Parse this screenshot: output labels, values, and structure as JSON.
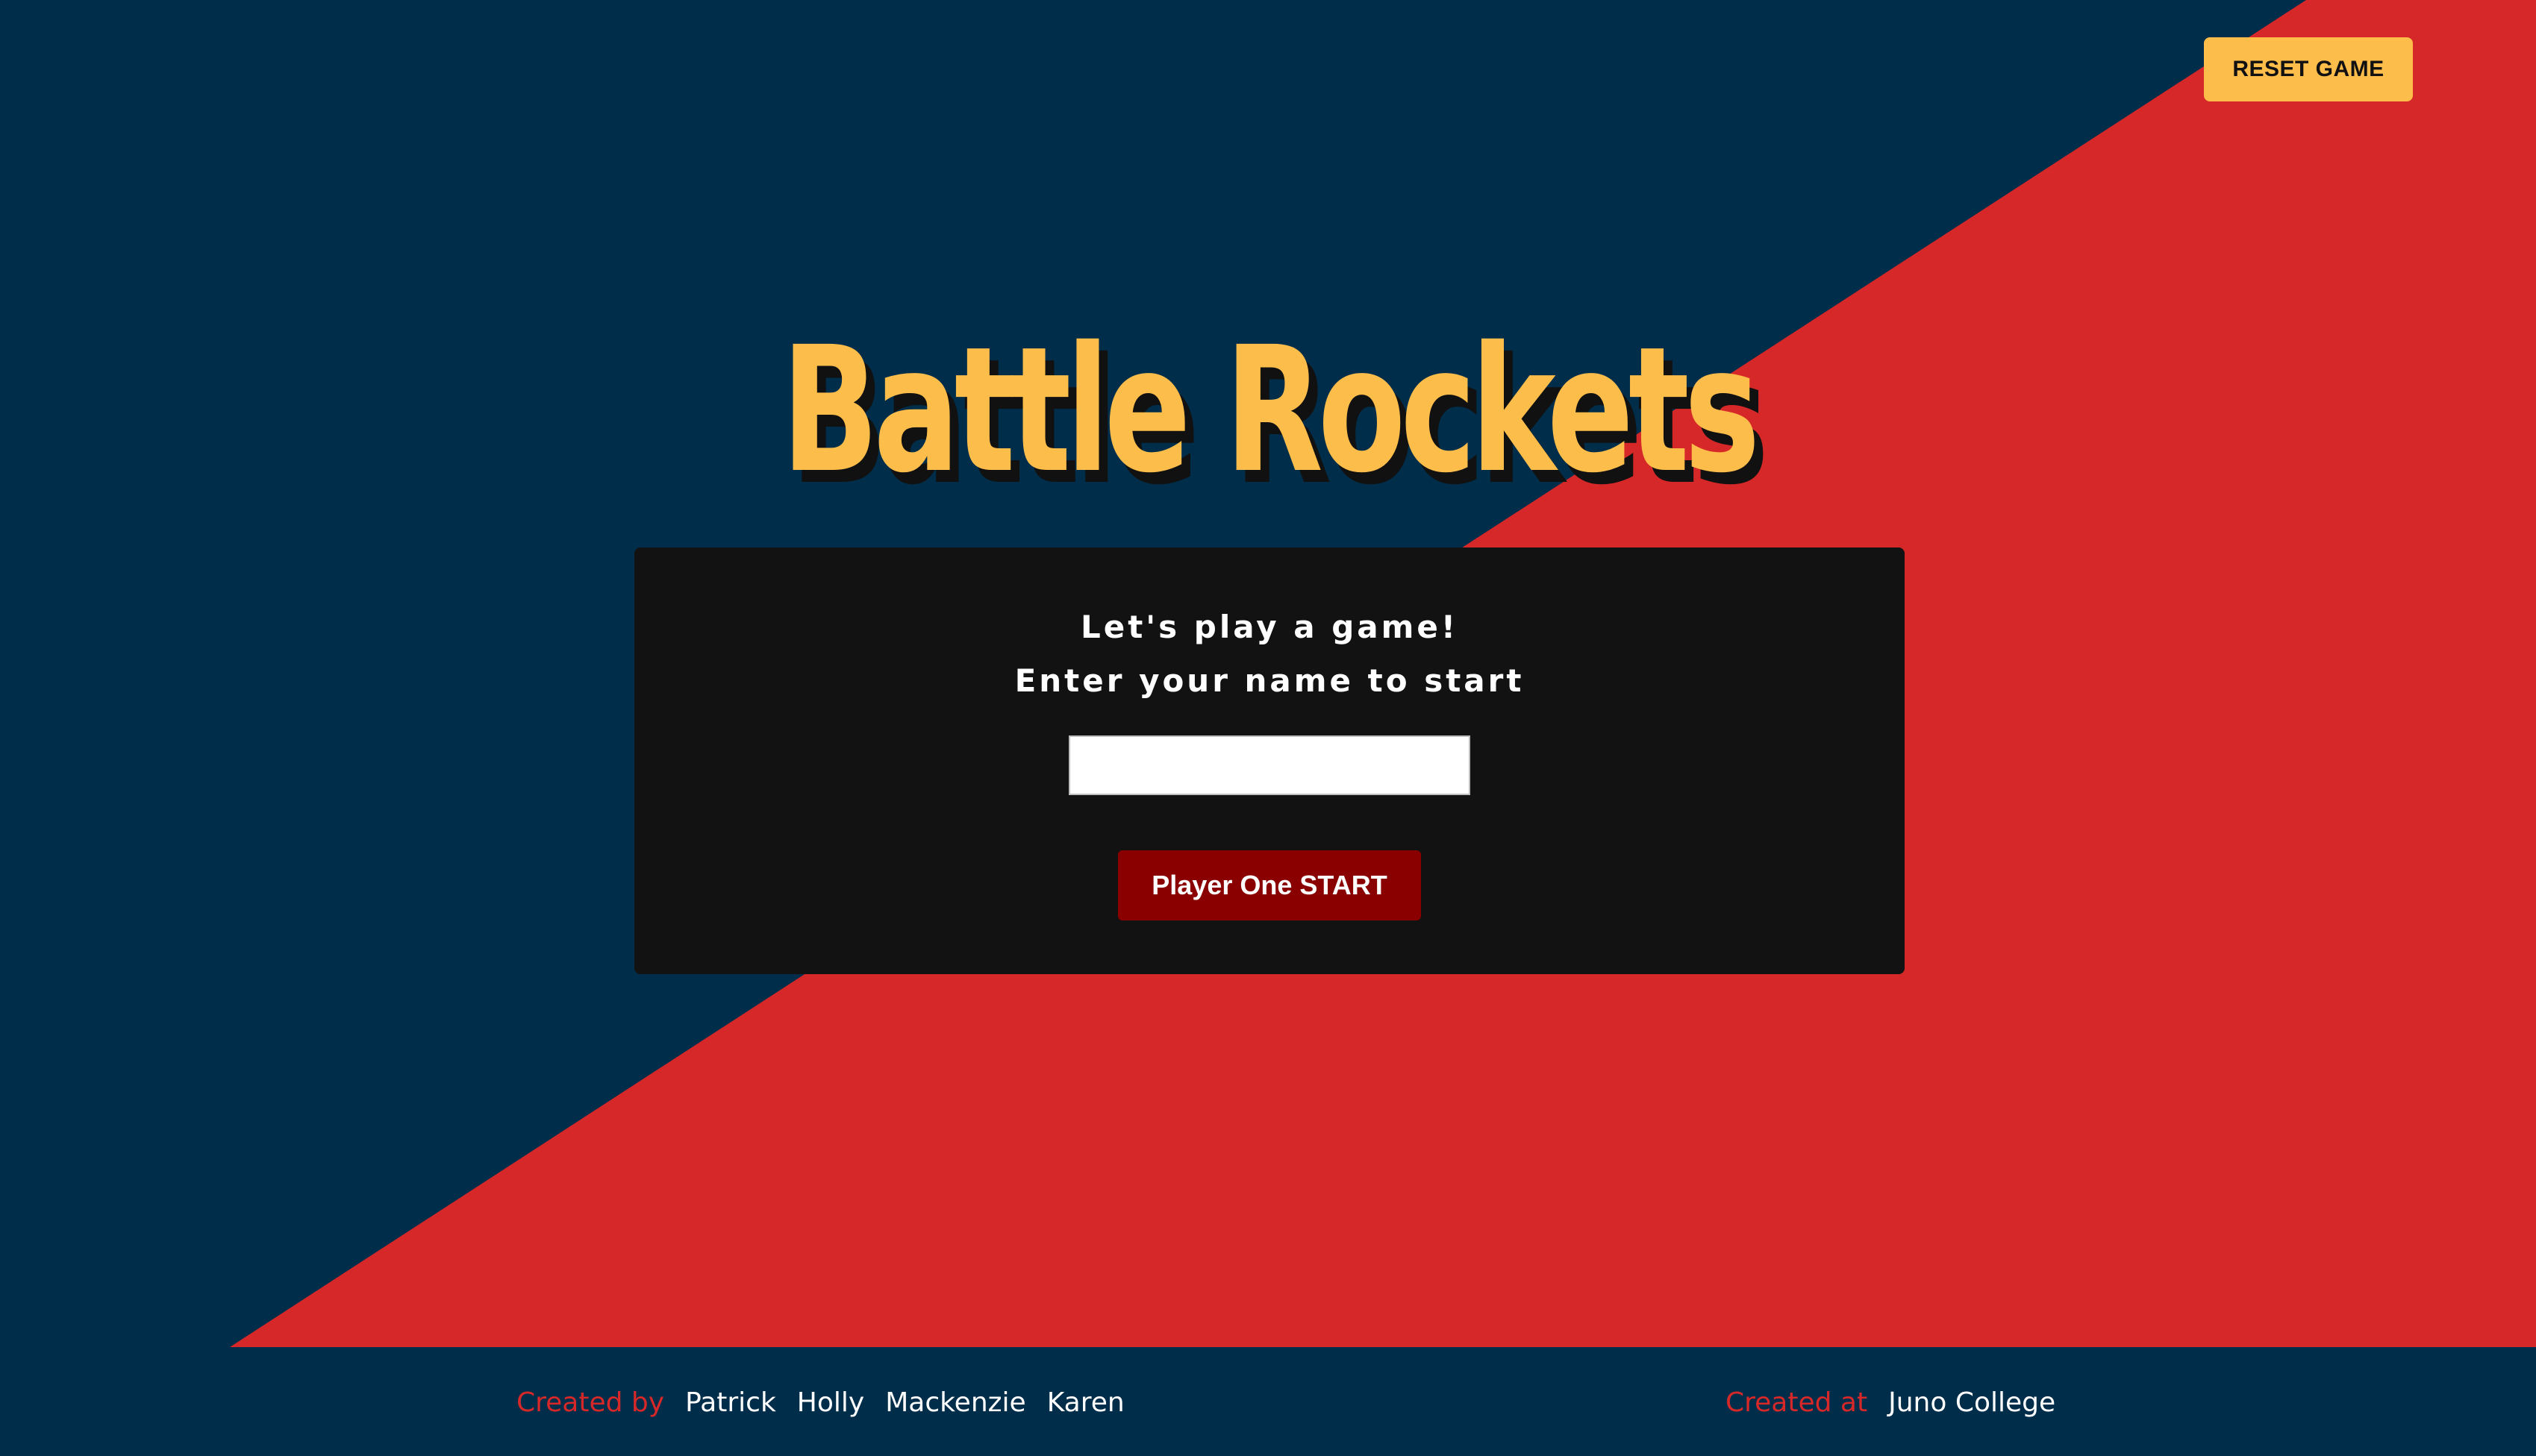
{
  "header": {
    "reset_label": "RESET GAME"
  },
  "title": "Battle Rockets",
  "panel": {
    "line1": "Let's play a game!",
    "line2": "Enter your name to start",
    "name_input_value": "",
    "start_label": "Player One START"
  },
  "footer": {
    "created_by_label": "Created by",
    "creators": [
      "Patrick",
      "Holly",
      "Mackenzie",
      "Karen"
    ],
    "created_at_label": "Created at",
    "school": "Juno College"
  },
  "colors": {
    "background_navy": "#002d4a",
    "diagonal_red": "#d62828",
    "accent_yellow": "#fdbd4a",
    "panel_black": "#121212",
    "start_button": "#8a0000"
  }
}
